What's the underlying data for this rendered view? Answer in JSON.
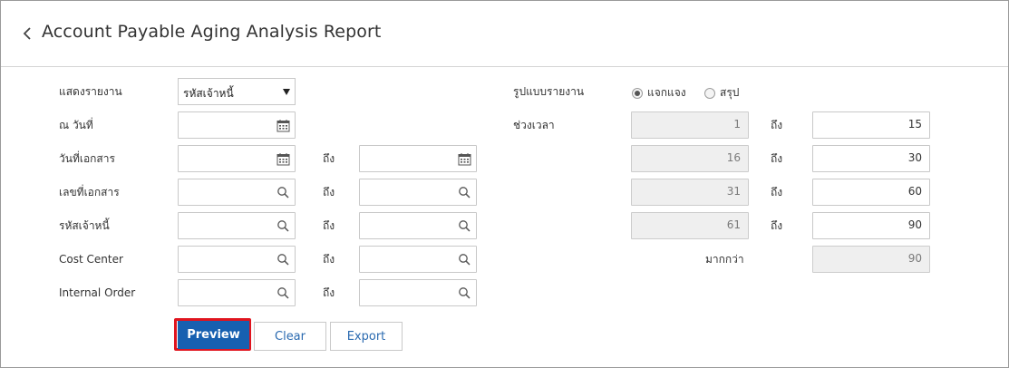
{
  "header": {
    "title": "Account Payable Aging Analysis Report"
  },
  "icons": {
    "back": "chevron-left-icon",
    "calendar": "calendar-icon",
    "search": "search-icon"
  },
  "colors": {
    "primary": "#1760b0",
    "highlight": "#e0141e",
    "readonly_bg": "#efefef"
  },
  "form": {
    "show_report": {
      "label": "แสดงรายงาน",
      "value": "รหัสเจ้าหนี้"
    },
    "as_of_date": {
      "label": "ณ วันที่",
      "value": ""
    },
    "doc_date": {
      "label": "วันที่เอกสาร",
      "from": "",
      "to_label": "ถึง",
      "to": ""
    },
    "doc_no": {
      "label": "เลขที่เอกสาร",
      "from": "",
      "to_label": "ถึง",
      "to": ""
    },
    "vendor_code": {
      "label": "รหัสเจ้าหนี้",
      "from": "",
      "to_label": "ถึง",
      "to": ""
    },
    "cost_center": {
      "label": "Cost Center",
      "from": "",
      "to_label": "ถึง",
      "to": ""
    },
    "internal_order": {
      "label": "Internal Order",
      "from": "",
      "to_label": "ถึง",
      "to": ""
    }
  },
  "report_format": {
    "label": "รูปแบบรายงาน",
    "options": [
      {
        "label": "แจกแจง",
        "selected": true
      },
      {
        "label": "สรุป",
        "selected": false
      }
    ]
  },
  "period": {
    "label": "ช่วงเวลา",
    "to_label": "ถึง",
    "ranges": [
      {
        "from": "1",
        "to": "15"
      },
      {
        "from": "16",
        "to": "30"
      },
      {
        "from": "31",
        "to": "60"
      },
      {
        "from": "61",
        "to": "90"
      }
    ],
    "more_than_label": "มากกว่า",
    "more_than": "90"
  },
  "buttons": {
    "preview": "Preview",
    "clear": "Clear",
    "export": "Export"
  }
}
